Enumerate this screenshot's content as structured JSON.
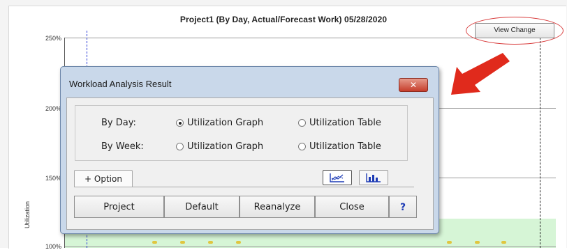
{
  "chart": {
    "title": "Project1  (By Day, Actual/Forecast Work) 05/28/2020",
    "ylabel": "Utilization",
    "yticks": [
      "250%",
      "200%",
      "150%",
      "100%"
    ]
  },
  "toolbar": {
    "view_change_label": "View Change"
  },
  "dialog": {
    "title": "Workload Analysis Result",
    "close_glyph": "✕",
    "rows": [
      {
        "label": "By Day:",
        "options": [
          {
            "label": "Utilization Graph",
            "checked": true
          },
          {
            "label": "Utilization Table",
            "checked": false
          }
        ]
      },
      {
        "label": "By Week:",
        "options": [
          {
            "label": "Utilization Graph",
            "checked": false
          },
          {
            "label": "Utilization Table",
            "checked": false
          }
        ]
      }
    ],
    "option_tab": "+ Option",
    "icon_buttons": [
      {
        "icon": "line-chart-icon",
        "pressed": true
      },
      {
        "icon": "bar-chart-icon",
        "pressed": false
      }
    ],
    "buttons": {
      "project": "Project",
      "default": "Default",
      "reanalyze": "Reanalyze",
      "close": "Close",
      "help": "?"
    }
  },
  "colors": {
    "annotation_red": "#d83a3a",
    "marker_blue": "#2a3bd6",
    "band_green": "#d6f5d6",
    "dialog_frame": "#c9d8ea"
  }
}
